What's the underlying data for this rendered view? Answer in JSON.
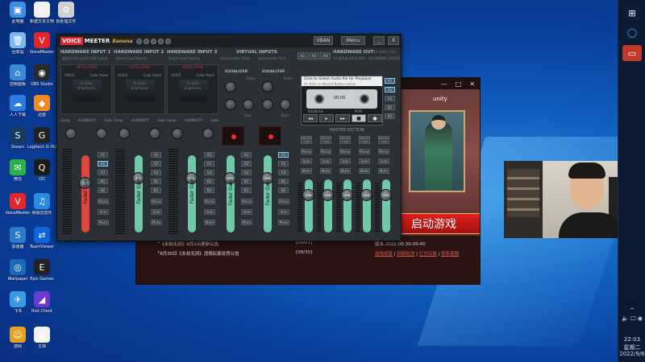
{
  "desktop_icons": [
    {
      "label": "此电脑",
      "color": "#3b8ee0",
      "glyph": "▣"
    },
    {
      "label": "新建文本文档",
      "color": "#f2f2f2",
      "glyph": "≡"
    },
    {
      "label": "批处理文件",
      "color": "#d0d0d0",
      "glyph": "⚙"
    },
    {
      "label": "回收站",
      "color": "#7cb8f0",
      "glyph": "🗑"
    },
    {
      "label": "VoiceMeeter",
      "color": "#e1262c",
      "glyph": "V"
    },
    {
      "label": "控制面板",
      "color": "#3a8ad8",
      "glyph": "⌂"
    },
    {
      "label": "OBS Studio",
      "color": "#2a2a2a",
      "glyph": "◉"
    },
    {
      "label": "人人下载",
      "color": "#2d7be0",
      "glyph": "☁"
    },
    {
      "label": "迅雷",
      "color": "#f08a24",
      "glyph": "◆"
    },
    {
      "label": "Steam",
      "color": "#173a5e",
      "glyph": "S"
    },
    {
      "label": "Logitech G HUB",
      "color": "#222",
      "glyph": "G"
    },
    {
      "label": "微信",
      "color": "#2bb24c",
      "glyph": "✉"
    },
    {
      "label": "QQ",
      "color": "#1a1a1a",
      "glyph": "Q"
    },
    {
      "label": "VoiceMeeter",
      "color": "#e1262c",
      "glyph": "V"
    },
    {
      "label": "网易云音乐",
      "color": "#2a8ae0",
      "glyph": "♫"
    },
    {
      "label": "加速器",
      "color": "#2a7ad0",
      "glyph": "S"
    },
    {
      "label": "TeamViewer",
      "color": "#0e64d8",
      "glyph": "⇄"
    },
    {
      "label": "Wallpaper",
      "color": "#1a6ab8",
      "glyph": "◎"
    },
    {
      "label": "Epic Games",
      "color": "#222",
      "glyph": "E"
    },
    {
      "label": "飞书",
      "color": "#3a9ae8",
      "glyph": "✈"
    },
    {
      "label": "Riot Client",
      "color": "#6a3ad0",
      "glyph": "◢"
    },
    {
      "label": "游戏",
      "color": "#e8a020",
      "glyph": "☺"
    },
    {
      "label": "文档",
      "color": "#f2f2f2",
      "glyph": "▤"
    }
  ],
  "taskbar": {
    "time": "22:03",
    "weekday": "星期二",
    "date": "2022/9/6"
  },
  "launcher": {
    "window_buttons": [
      "—",
      "□",
      "✕"
    ],
    "unity_label": "unity",
    "play_button": "启动游戏",
    "news": [
      {
        "title": "《永劫无间》9月1日更新公告",
        "date": "[09/01]"
      },
      {
        "title": "8月30日《永劫无间》违规玩家处罚公告",
        "date": "[08/30]"
      }
    ],
    "version_line": "版本 2022-08-30-09-40",
    "links": [
      "游戏修复",
      "网络检测",
      "打开目录",
      "联系客服"
    ]
  },
  "voicemeeter": {
    "logo_a": "VOICE",
    "logo_b": "MEETER",
    "logo_c": "Banana",
    "vban": "VBAN",
    "menu": "Menu",
    "min": "_",
    "close": "X",
    "strips": [
      {
        "head": "HARDWARE INPUT 1",
        "sub": "麦克风 (Focusrite USB Audio)",
        "name": "INTELLIPAN",
        "fader_value": "2.0",
        "fader_color": "#e0443a",
        "fader_pos": 0.72
      },
      {
        "head": "HARDWARE INPUT 2",
        "sub": "Select Input Device",
        "name": "INTELLIPAN",
        "fader_value": "0dB",
        "fader_color": "#6fc9a8",
        "fader_pos": 0.78
      },
      {
        "head": "HARDWARE INPUT 3",
        "sub": "Select Input Device",
        "name": "INTELLIPAN",
        "fader_value": "0dB",
        "fader_color": "#6fc9a8",
        "fader_pos": 0.78
      }
    ],
    "panel_labels": {
      "voice": "VOICE",
      "color": "Color Panel",
      "fx": "fx echo",
      "bright": "Brightness"
    },
    "knob_labels": [
      "Comp",
      "AUDIBILITY",
      "Gate"
    ],
    "virtual_head": "VIRTUAL INPUTS",
    "virtual_strips": [
      {
        "sub": "Voicemeeter VAIO",
        "name": "EQUALIZER",
        "fader_value": "0dB",
        "fader_pos": 0.78
      },
      {
        "sub": "Voicemeeter AUX",
        "name": "EQUALIZER",
        "fader_value": "0dB",
        "fader_pos": 0.78
      }
    ],
    "eq_labels": {
      "treble": "Treble",
      "bass": "Bass"
    },
    "bus_labels": [
      "A1",
      "A2",
      "A3",
      "B1",
      "B2"
    ],
    "mute": "Mute",
    "solo": "Solo",
    "mono": "Mono",
    "fader_text": "Fader Gain",
    "hw_out_head": "HARDWARE OUT",
    "hw_out_rate": "44.1kHz | 512",
    "hw_out_sub": "A1 扬声器 (REALTEK) · A2 GAMING SOUND",
    "out_tabs": [
      "A1",
      "A2",
      "A3"
    ],
    "cassette": {
      "hdr1": "Click to Select Audio file for Playback",
      "hdr2": "Or click on Record Button below",
      "time": "00:00",
      "rate": "44100 Hz",
      "format": "PCM"
    },
    "master_title": "MASTER SECTION",
    "master_buses": [
      {
        "label": "Normal mode",
        "value": "0dB"
      },
      {
        "label": "Normal mode",
        "value": "0dB"
      },
      {
        "label": "Normal mode",
        "value": "0dB"
      },
      {
        "label": "Normal mode",
        "value": "0dB"
      },
      {
        "label": "Normal mode",
        "value": "0dB"
      }
    ]
  }
}
